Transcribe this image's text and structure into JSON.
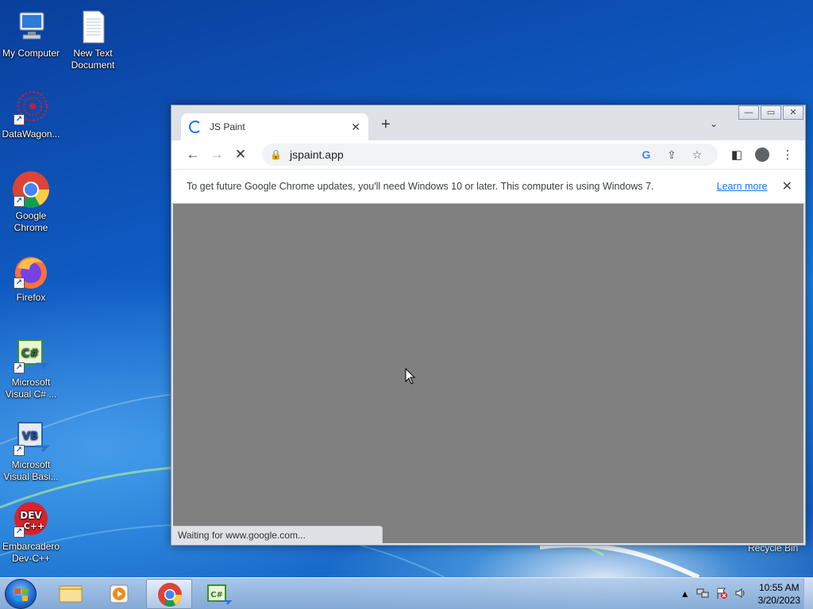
{
  "desktop": {
    "icons": [
      {
        "label": "My Computer"
      },
      {
        "label": "New Text Document"
      },
      {
        "label": "DataWagon..."
      },
      {
        "label": "Google Chrome"
      },
      {
        "label": "Firefox"
      },
      {
        "label": "Microsoft Visual C# ..."
      },
      {
        "label": "Microsoft Visual Basi..."
      },
      {
        "label": "Embarcadero Dev-C++"
      }
    ],
    "recycle_bin": "Recycle Bin"
  },
  "window": {
    "controls": {
      "minimize": "—",
      "maximize": "▭",
      "close": "✕"
    }
  },
  "browser": {
    "tab": {
      "title": "JS Paint",
      "close": "✕"
    },
    "new_tab": "+",
    "tab_dropdown": "⌄",
    "toolbar": {
      "back": "←",
      "forward": "→",
      "stop": "✕"
    },
    "omnibox": {
      "url": "jspaint.app",
      "lock": "🔒",
      "google": "G",
      "share": "⇪",
      "star": "☆"
    },
    "side_panel": "◧",
    "menu": "⋮",
    "infobar": {
      "message": "To get future Google Chrome updates, you'll need Windows 10 or later. This computer is using Windows 7.",
      "learn_more": "Learn more",
      "close": "✕"
    },
    "status": "Waiting for www.google.com..."
  },
  "taskbar": {
    "clock_time": "10:55 AM",
    "clock_date": "3/20/2023",
    "tray_expand": "▲"
  },
  "colors": {
    "accent": "#1a73e8",
    "content_bg": "#808080",
    "desktop": "#1769c8"
  }
}
